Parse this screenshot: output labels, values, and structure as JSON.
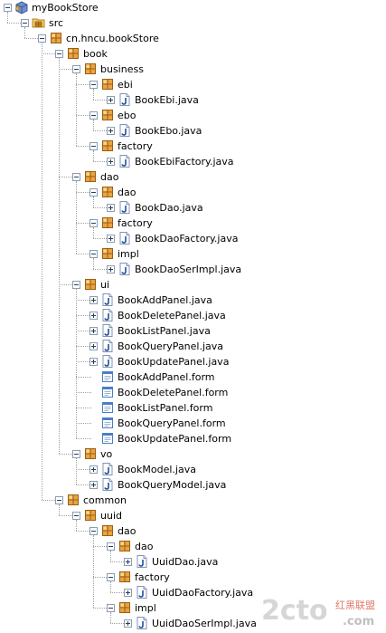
{
  "nodes": [
    {
      "label": "myBookStore",
      "icon": "project-icon",
      "depth": 0,
      "toggle": "minus"
    },
    {
      "label": "src",
      "icon": "source-folder-icon",
      "depth": 1,
      "toggle": "minus"
    },
    {
      "label": "cn.hncu.bookStore",
      "icon": "package-icon",
      "depth": 2,
      "toggle": "minus"
    },
    {
      "label": "book",
      "icon": "package-icon",
      "depth": 3,
      "toggle": "minus"
    },
    {
      "label": "business",
      "icon": "package-icon",
      "depth": 4,
      "toggle": "minus"
    },
    {
      "label": "ebi",
      "icon": "package-icon",
      "depth": 5,
      "toggle": "minus"
    },
    {
      "label": "BookEbi.java",
      "icon": "java-file-icon",
      "depth": 6,
      "toggle": "plus"
    },
    {
      "label": "ebo",
      "icon": "package-icon",
      "depth": 5,
      "toggle": "minus"
    },
    {
      "label": "BookEbo.java",
      "icon": "java-file-icon",
      "depth": 6,
      "toggle": "plus"
    },
    {
      "label": "factory",
      "icon": "package-icon",
      "depth": 5,
      "toggle": "minus"
    },
    {
      "label": "BookEbiFactory.java",
      "icon": "java-file-icon",
      "depth": 6,
      "toggle": "plus"
    },
    {
      "label": "dao",
      "icon": "package-icon",
      "depth": 4,
      "toggle": "minus"
    },
    {
      "label": "dao",
      "icon": "package-icon",
      "depth": 5,
      "toggle": "minus"
    },
    {
      "label": "BookDao.java",
      "icon": "java-file-icon",
      "depth": 6,
      "toggle": "plus"
    },
    {
      "label": "factory",
      "icon": "package-icon",
      "depth": 5,
      "toggle": "minus"
    },
    {
      "label": "BookDaoFactory.java",
      "icon": "java-file-icon",
      "depth": 6,
      "toggle": "plus"
    },
    {
      "label": "impl",
      "icon": "package-icon",
      "depth": 5,
      "toggle": "minus"
    },
    {
      "label": "BookDaoSerImpl.java",
      "icon": "java-file-icon",
      "depth": 6,
      "toggle": "plus"
    },
    {
      "label": "ui",
      "icon": "package-icon",
      "depth": 4,
      "toggle": "minus"
    },
    {
      "label": "BookAddPanel.java",
      "icon": "java-file-icon",
      "depth": 5,
      "toggle": "plus"
    },
    {
      "label": "BookDeletePanel.java",
      "icon": "java-file-icon",
      "depth": 5,
      "toggle": "plus"
    },
    {
      "label": "BookListPanel.java",
      "icon": "java-file-icon",
      "depth": 5,
      "toggle": "plus"
    },
    {
      "label": "BookQueryPanel.java",
      "icon": "java-file-icon",
      "depth": 5,
      "toggle": "plus"
    },
    {
      "label": "BookUpdatePanel.java",
      "icon": "java-file-icon",
      "depth": 5,
      "toggle": "plus"
    },
    {
      "label": "BookAddPanel.form",
      "icon": "form-file-icon",
      "depth": 5,
      "toggle": "none"
    },
    {
      "label": "BookDeletePanel.form",
      "icon": "form-file-icon",
      "depth": 5,
      "toggle": "none"
    },
    {
      "label": "BookListPanel.form",
      "icon": "form-file-icon",
      "depth": 5,
      "toggle": "none"
    },
    {
      "label": "BookQueryPanel.form",
      "icon": "form-file-icon",
      "depth": 5,
      "toggle": "none"
    },
    {
      "label": "BookUpdatePanel.form",
      "icon": "form-file-icon",
      "depth": 5,
      "toggle": "none"
    },
    {
      "label": "vo",
      "icon": "package-icon",
      "depth": 4,
      "toggle": "minus"
    },
    {
      "label": "BookModel.java",
      "icon": "java-file-icon",
      "depth": 5,
      "toggle": "plus"
    },
    {
      "label": "BookQueryModel.java",
      "icon": "java-file-icon",
      "depth": 5,
      "toggle": "plus"
    },
    {
      "label": "common",
      "icon": "package-icon",
      "depth": 3,
      "toggle": "minus"
    },
    {
      "label": "uuid",
      "icon": "package-icon",
      "depth": 4,
      "toggle": "minus"
    },
    {
      "label": "dao",
      "icon": "package-icon",
      "depth": 5,
      "toggle": "minus"
    },
    {
      "label": "dao",
      "icon": "package-icon",
      "depth": 6,
      "toggle": "minus"
    },
    {
      "label": "UuidDao.java",
      "icon": "java-file-icon",
      "depth": 7,
      "toggle": "plus"
    },
    {
      "label": "factory",
      "icon": "package-icon",
      "depth": 6,
      "toggle": "minus"
    },
    {
      "label": "UuidDaoFactory.java",
      "icon": "java-file-icon",
      "depth": 7,
      "toggle": "plus"
    },
    {
      "label": "impl",
      "icon": "package-icon",
      "depth": 6,
      "toggle": "minus"
    },
    {
      "label": "UuidDaoSerImpl.java",
      "icon": "java-file-icon",
      "depth": 7,
      "toggle": "plus"
    }
  ],
  "watermark": {
    "logo_text": "2cto",
    "logo_suffix": ".com",
    "right_line1": "红黑联盟",
    "colors": {
      "logo": "#d9d9d9",
      "right_red": "#e07b6c",
      "right_gray": "#bdbdbd"
    }
  },
  "colors": {
    "package": "#b8731f",
    "package_light": "#f4d36a",
    "java": "#2a5ca8",
    "form": "#3d7bc4",
    "project": "#5b79b6"
  }
}
